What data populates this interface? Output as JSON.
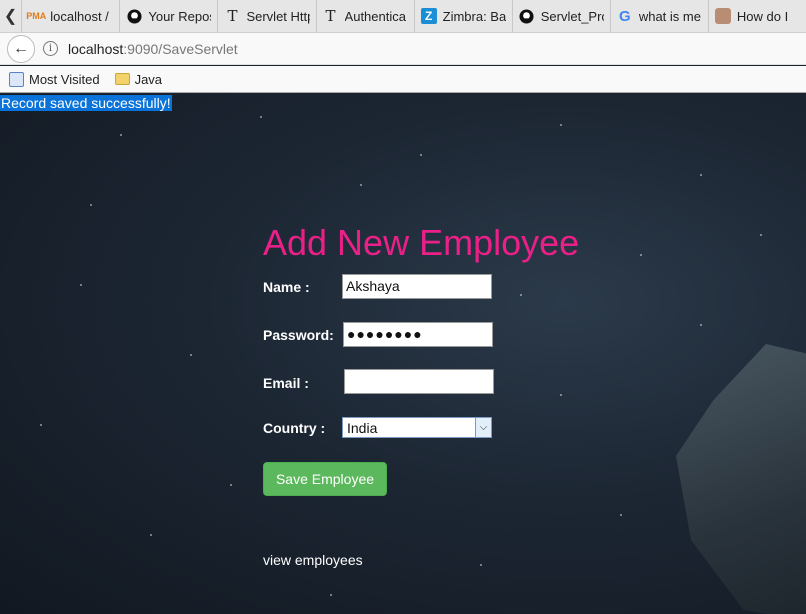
{
  "browser": {
    "tabs": [
      {
        "label": "localhost /",
        "icon": "phpmyadmin-icon"
      },
      {
        "label": "Your Repos",
        "icon": "github-icon"
      },
      {
        "label": "Servlet Http",
        "icon": "text-icon"
      },
      {
        "label": "Authentica",
        "icon": "text-icon"
      },
      {
        "label": "Zimbra: Ba",
        "icon": "zimbra-icon"
      },
      {
        "label": "Servlet_Pro",
        "icon": "github-icon"
      },
      {
        "label": "what is me",
        "icon": "google-icon"
      },
      {
        "label": "How do I",
        "icon": "avatar-icon"
      }
    ],
    "url_host": "localhost",
    "url_rest": ":9090/SaveServlet",
    "bookmarks": [
      {
        "label": "Most Visited",
        "icon": "most-visited-icon"
      },
      {
        "label": "Java",
        "icon": "folder-icon"
      }
    ]
  },
  "page": {
    "message": "Record saved successfully!",
    "title": "Add New Employee",
    "name_label": "Name :",
    "name_value": "Akshaya",
    "password_label": "Password:",
    "password_mask": "●●●●●●●●",
    "email_label": "Email :",
    "email_value": "",
    "country_label": "Country :",
    "country_value": "India",
    "save_label": "Save Employee",
    "view_link": "view employees"
  },
  "colors": {
    "title": "#ea2088",
    "message_bg": "#0a73d9",
    "button": "#5cb85c"
  }
}
